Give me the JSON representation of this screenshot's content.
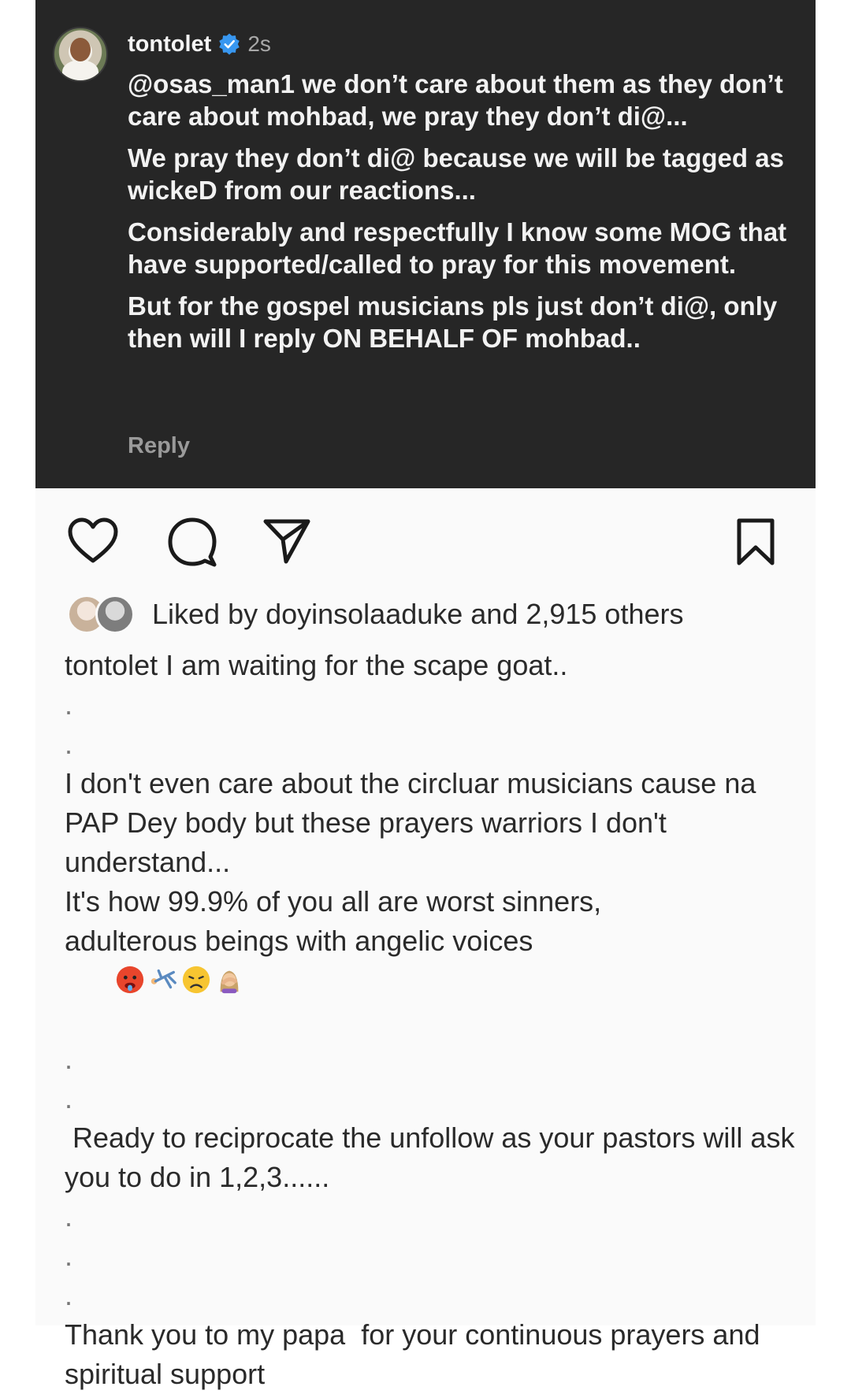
{
  "comment": {
    "username": "tontolet",
    "time": "2s",
    "paragraphs": [
      "@osas_man1 we don’t care about them as they don’t care about mohbad, we pray they don’t di@...",
      "We pray they don’t di@ because we will be tagged as wickeD from our reactions...",
      "Considerably and respectfully I know some MOG that have supported/called to pray for this movement.",
      "But for the gospel musicians pls just don’t di@, only then will I reply ON BEHALF OF  mohbad.."
    ],
    "reply_label": "Reply"
  },
  "actions": {
    "icons": [
      "heart-icon",
      "comment-icon",
      "share-icon",
      "bookmark-icon"
    ]
  },
  "likes": {
    "text": "Liked by doyinsolaaduke and 2,915 others"
  },
  "caption": {
    "line1": "tontolet I am waiting for the scape goat..",
    "dot": ".",
    "para1": "I don't even care about the circluar musicians cause na PAP Dey body but these prayers warriors I don't understand...",
    "para2a": "It's how 99.9% of you all are worst sinners,",
    "para2b": "adulterous beings with angelic voices",
    "para3": " Ready to reciprocate the unfollow as your pastors will ask you to do in 1,2,3......",
    "para4": "Thank you to my papa  for your continuous prayers and  spiritual support"
  },
  "colors": {
    "card_bg": "#262626",
    "verified": "#3897f0"
  }
}
